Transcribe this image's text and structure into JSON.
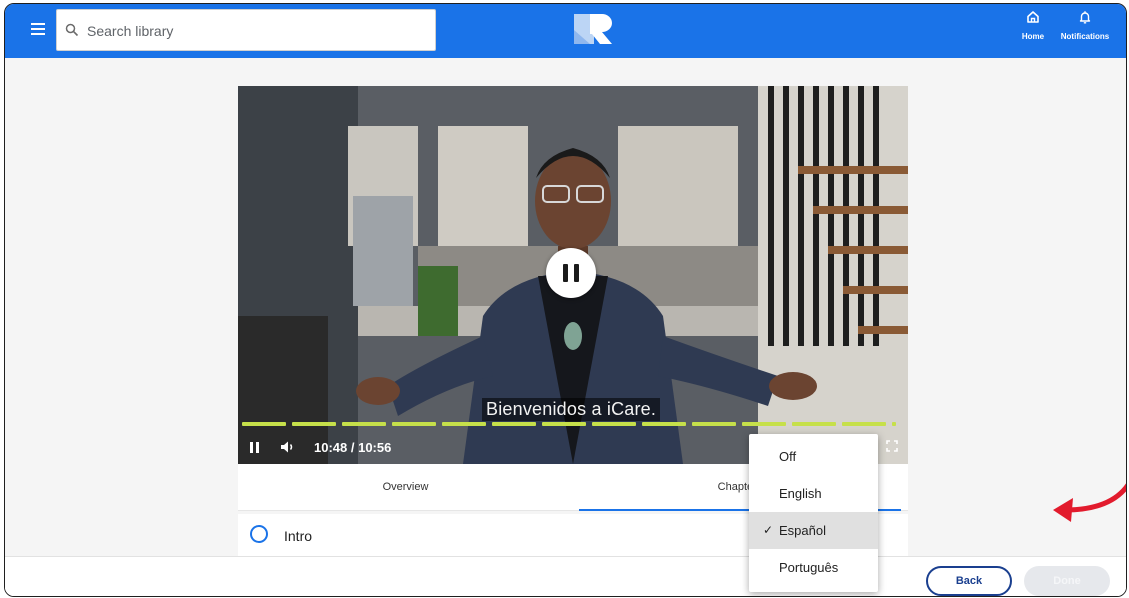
{
  "header": {
    "search_placeholder": "Search library",
    "home_label": "Home",
    "notifications_label": "Notifications"
  },
  "video": {
    "caption": "Bienvenidos a iCare.",
    "time": "10:48 / 10:56",
    "progress": 0.988,
    "state": "playing"
  },
  "tabs": [
    {
      "label": "Overview",
      "active": false
    },
    {
      "label": "Chapters",
      "active": true
    }
  ],
  "chapters": [
    {
      "label": "Intro"
    }
  ],
  "caption_menu": {
    "items": [
      {
        "label": "Off",
        "selected": false
      },
      {
        "label": "English",
        "selected": false
      },
      {
        "label": "Español",
        "selected": true
      },
      {
        "label": "Português",
        "selected": false
      }
    ]
  },
  "footer": {
    "back_label": "Back",
    "done_label": "Done"
  },
  "colors": {
    "brand": "#1a73e8",
    "progress": "#c6e04a",
    "annotation_arrow": "#e21b2d"
  }
}
